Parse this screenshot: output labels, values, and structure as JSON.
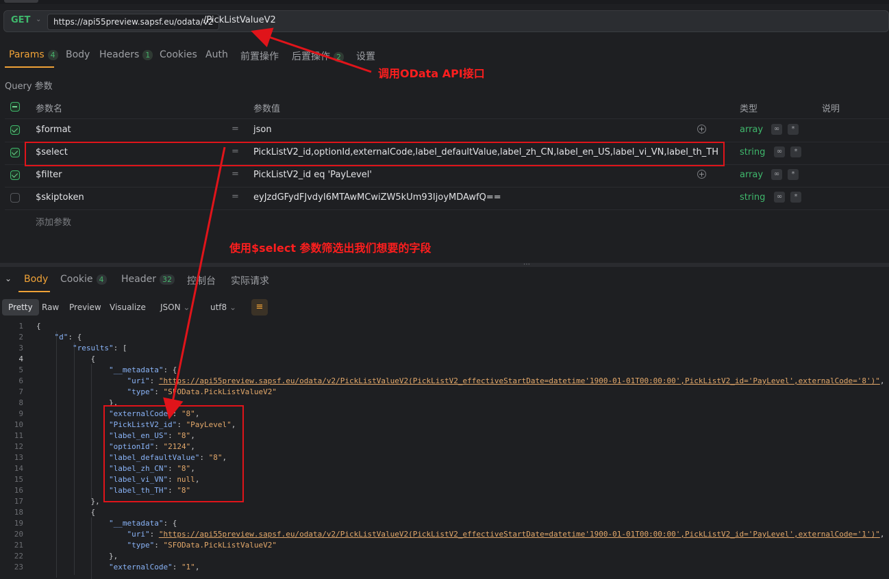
{
  "request": {
    "method": "GET",
    "base_url": "https://api55preview.sapsf.eu/odata/v2",
    "path": "/PickListValueV2"
  },
  "request_tabs": [
    {
      "label": "Params",
      "badge": "4"
    },
    {
      "label": "Body",
      "badge": ""
    },
    {
      "label": "Headers",
      "badge": "1"
    },
    {
      "label": "Cookies",
      "badge": ""
    },
    {
      "label": "Auth",
      "badge": ""
    },
    {
      "label": "前置操作",
      "badge": ""
    },
    {
      "label": "后置操作",
      "badge": "2"
    },
    {
      "label": "设置",
      "badge": ""
    }
  ],
  "query_section_label": "Query 参数",
  "params_header": {
    "name": "参数名",
    "value": "参数值",
    "type": "类型",
    "desc": "说明"
  },
  "params": [
    {
      "name": "$format",
      "eq": "=",
      "value": "json",
      "type": "array",
      "checked": true
    },
    {
      "name": "$select",
      "eq": "=",
      "value": "PickListV2_id,optionId,externalCode,label_defaultValue,label_zh_CN,label_en_US,label_vi_VN,label_th_TH",
      "type": "string",
      "checked": true
    },
    {
      "name": "$filter",
      "eq": "=",
      "value": "PickListV2_id eq 'PayLevel'",
      "type": "array",
      "checked": true
    },
    {
      "name": "$skiptoken",
      "eq": "=",
      "value": "eyJzdGFydFJvdyI6MTAwMCwiZW5kUm93IjoyMDAwfQ==",
      "type": "string",
      "checked": false
    }
  ],
  "add_param_label": "添加参数",
  "response_tabs": [
    {
      "label": "Body",
      "badge": ""
    },
    {
      "label": "Cookie",
      "badge": "4"
    },
    {
      "label": "Header",
      "badge": "32"
    },
    {
      "label": "控制台",
      "badge": ""
    },
    {
      "label": "实际请求",
      "badge": ""
    }
  ],
  "view_tabs": [
    "Pretty",
    "Raw",
    "Preview",
    "Visualize"
  ],
  "format_select": "JSON",
  "encoding_select": "utf8",
  "icons": {
    "collapse": "chevron-down-icon",
    "wrap": "word-wrap-icon",
    "add": "plus-circle-icon"
  },
  "annotations": {
    "api_call": "调用OData API接口",
    "select_filter": "使用$select 参数筛选出我们想要的字段"
  },
  "code_lines": [
    {
      "n": "1",
      "t": "{"
    },
    {
      "n": "2",
      "t": "    \"d\": {"
    },
    {
      "n": "3",
      "t": "        \"results\": ["
    },
    {
      "n": "4",
      "t": "            {"
    },
    {
      "n": "5",
      "t": "                \"__metadata\": {"
    },
    {
      "n": "6",
      "k": "                    \"uri\": ",
      "v": "\"https://api55preview.sapsf.eu/odata/v2/PickListValueV2(PickListV2_effectiveStartDate=datetime'1900-01-01T00:00:00',PickListV2_id='PayLevel',externalCode='8')\"",
      "e": ","
    },
    {
      "n": "7",
      "k": "                    \"type\": ",
      "v": "\"SFOData.PickListValueV2\"",
      "e": ""
    },
    {
      "n": "8",
      "t": "                },"
    },
    {
      "n": "9",
      "k": "                \"externalCode\": ",
      "v": "\"8\"",
      "e": ","
    },
    {
      "n": "10",
      "k": "                \"PickListV2_id\": ",
      "v": "\"PayLevel\"",
      "e": ","
    },
    {
      "n": "11",
      "k": "                \"label_en_US\": ",
      "v": "\"8\"",
      "e": ","
    },
    {
      "n": "12",
      "k": "                \"optionId\": ",
      "v": "\"2124\"",
      "e": ","
    },
    {
      "n": "13",
      "k": "                \"label_defaultValue\": ",
      "v": "\"8\"",
      "e": ","
    },
    {
      "n": "14",
      "k": "                \"label_zh_CN\": ",
      "v": "\"8\"",
      "e": ","
    },
    {
      "n": "15",
      "k": "                \"label_vi_VN\": ",
      "v": "null",
      "e": ","
    },
    {
      "n": "16",
      "k": "                \"label_th_TH\": ",
      "v": "\"8\"",
      "e": ""
    },
    {
      "n": "17",
      "t": "            },"
    },
    {
      "n": "18",
      "t": "            {"
    },
    {
      "n": "19",
      "t": "                \"__metadata\": {"
    },
    {
      "n": "20",
      "k": "                    \"uri\": ",
      "v": "\"https://api55preview.sapsf.eu/odata/v2/PickListValueV2(PickListV2_effectiveStartDate=datetime'1900-01-01T00:00:00',PickListV2_id='PayLevel',externalCode='1')\"",
      "e": ","
    },
    {
      "n": "21",
      "k": "                    \"type\": ",
      "v": "\"SFOData.PickListValueV2\"",
      "e": ""
    },
    {
      "n": "22",
      "t": "                },"
    },
    {
      "n": "23",
      "k": "                \"externalCode\": ",
      "v": "\"1\"",
      "e": ","
    }
  ],
  "colors": {
    "accent": "#f0a237",
    "success": "#3fb86c",
    "annotation": "#e0141a"
  }
}
